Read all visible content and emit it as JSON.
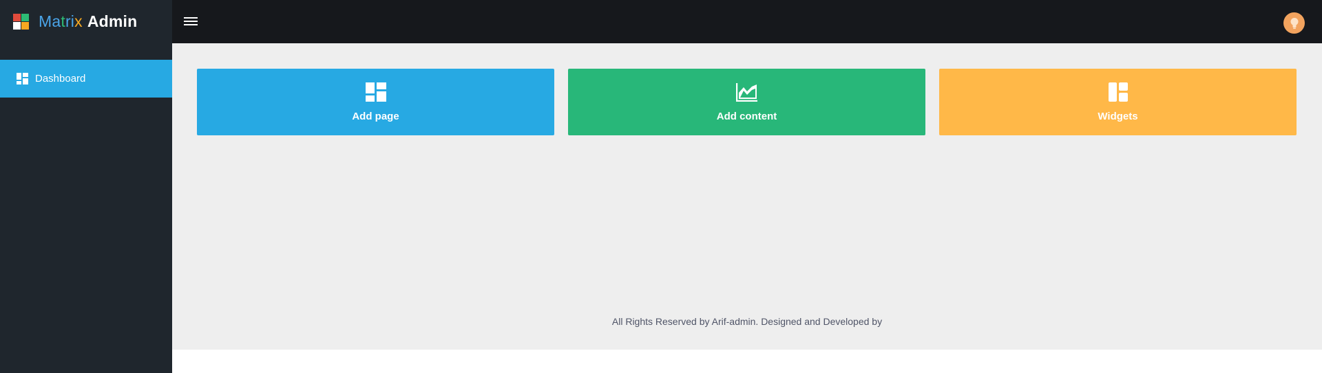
{
  "brand": {
    "part1": "Ma",
    "part2": "t",
    "part3": "ri",
    "part4": "x",
    "admin": "Admin"
  },
  "colors": {
    "logo_squares": [
      "#e04b3c",
      "#2dba74",
      "#ffffff",
      "#f6a821"
    ],
    "brand_letters": [
      "#4aa4e8",
      "#2dba74",
      "#4aa4e8",
      "#f6a821"
    ],
    "sidebar_active": "#27a9e3",
    "cards": [
      "#27a9e3",
      "#28b779",
      "#ffb848"
    ]
  },
  "topbar": {
    "menu_icon": "hamburger-icon",
    "avatar_icon": "lightbulb-icon"
  },
  "sidebar": {
    "items": [
      {
        "label": "Dashboard",
        "icon": "dashboard-icon"
      }
    ]
  },
  "cards": [
    {
      "label": "Add page",
      "icon": "dashboard-icon"
    },
    {
      "label": "Add content",
      "icon": "area-chart-icon"
    },
    {
      "label": "Widgets",
      "icon": "widgets-icon"
    }
  ],
  "footer": {
    "text": "All Rights Reserved by Arif-admin. Designed and Developed by"
  }
}
